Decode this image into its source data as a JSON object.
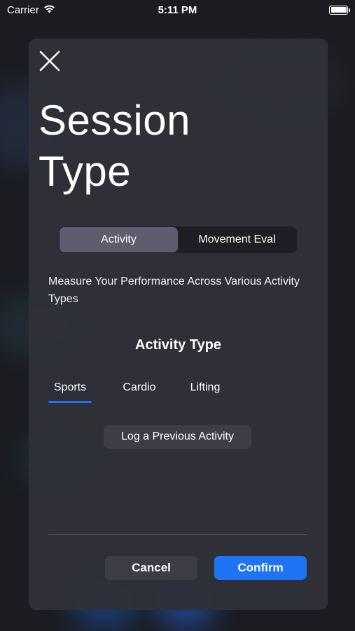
{
  "status_bar": {
    "carrier": "Carrier",
    "time": "5:11 PM",
    "icons": [
      "wifi-icon",
      "battery-icon"
    ]
  },
  "modal": {
    "title": "Session Type",
    "segments": [
      {
        "label": "Activity",
        "selected": true
      },
      {
        "label": "Movement Eval",
        "selected": false
      }
    ],
    "description": "Measure Your Performance Across Various Activity Types",
    "section_title": "Activity Type",
    "tabs": [
      {
        "label": "Sports",
        "selected": true
      },
      {
        "label": "Cardio",
        "selected": false
      },
      {
        "label": "Lifting",
        "selected": false
      }
    ],
    "log_previous_label": "Log a Previous Activity",
    "cancel_label": "Cancel",
    "confirm_label": "Confirm"
  },
  "colors": {
    "accent": "#1f74f5",
    "modal_bg": "#303138",
    "segment_active": "#5e5c6e"
  }
}
